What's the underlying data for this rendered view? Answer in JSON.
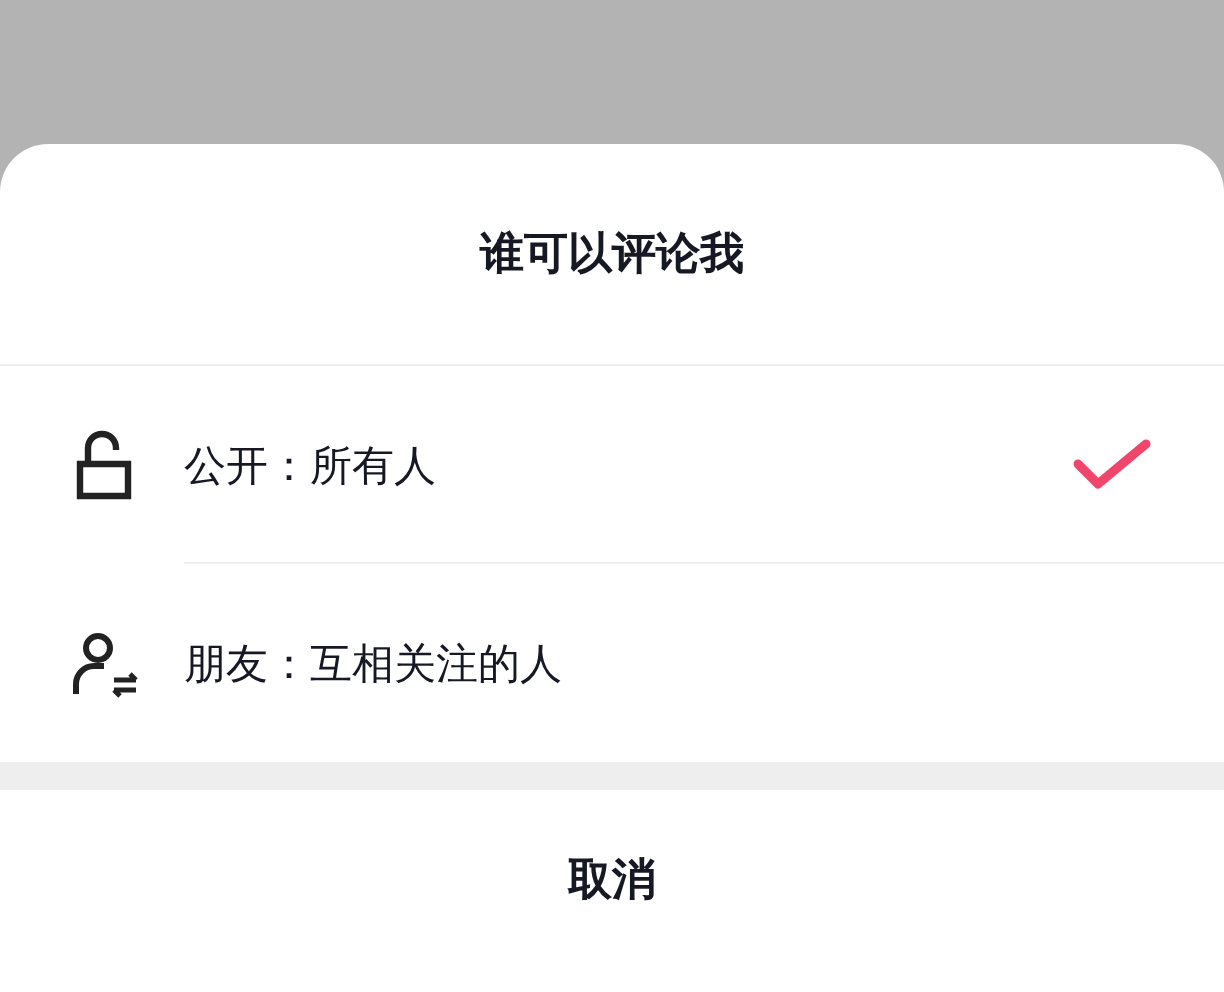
{
  "sheet": {
    "title": "谁可以评论我",
    "options": [
      {
        "kind": "public",
        "label": "公开：所有人",
        "selected": true
      },
      {
        "kind": "friends",
        "label": "朋友：互相关注的人",
        "selected": false
      }
    ],
    "cancel": "取消"
  }
}
